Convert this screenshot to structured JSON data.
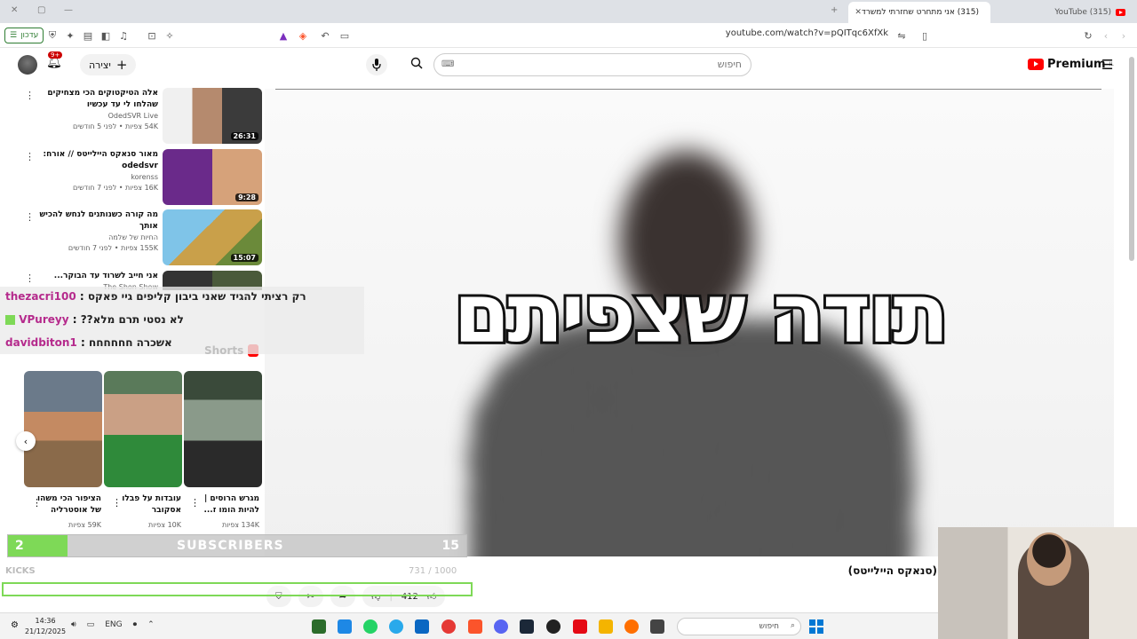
{
  "browser": {
    "tabs": [
      {
        "title": "(315) אני מתחרט שחזרתי למשרד",
        "active": true
      },
      {
        "title": "(315) YouTube",
        "active": false
      }
    ],
    "update_button": "עדכון",
    "url": "youtube.com/watch?v=pQITqc6XfXk"
  },
  "header": {
    "logo_text": "Premium",
    "logo_superscript": "IL",
    "search_placeholder": "חיפוש",
    "create_label": "יצירה",
    "notification_count": "9+"
  },
  "player": {
    "overlay_text": "תודה שצפיתם"
  },
  "video": {
    "title": "(סנאקס היילייטס)",
    "likes": "412"
  },
  "related": [
    {
      "title": "אלה הטיקטוקים הכי מצחיקים שהלחו לי עד עכשיו",
      "channel": "OdedSVR Live",
      "meta": "54K צפיות • לפני 5 חודשים",
      "duration": "26:31"
    },
    {
      "title": "מאור סנאקס היילייטס // אורח: odedsvr",
      "channel": "korenss",
      "meta": "16K צפיות • לפני 7 חודשים",
      "duration": "9:28"
    },
    {
      "title": "מה קורה כשנותנים לנחש להכיש אותך",
      "channel": "החיות של שלמה",
      "meta": "155K צפיות • לפני 7 חודשים",
      "duration": "15:07"
    },
    {
      "title": "אני חייב לשרוד עד הבוקר...",
      "channel": "The Shon Show",
      "meta": "",
      "duration": ""
    }
  ],
  "shorts": {
    "heading": "Shorts",
    "items": [
      {
        "title": "הציפור הכי משהו של אוסטרליה",
        "views": "59K צפיות"
      },
      {
        "title": "עובדות על פבלו אסקובר",
        "views": "10K צפיות"
      },
      {
        "title": "מגרש הרוסים | להיות הומו ז...",
        "views": "134K צפיות"
      }
    ]
  },
  "chat": [
    {
      "user": "thezacri100",
      "message": "רק רציתי להגיד שאני ביבון קליפים גיי פאקס"
    },
    {
      "user": "VPureyy",
      "message": "לא נסטי תרם מלא??"
    },
    {
      "user": "davidbiton1",
      "message": "אשכרה חחחחחח"
    }
  ],
  "sub_goal": {
    "current": "2",
    "label": "SUBSCRIBERS",
    "goal": "15",
    "progress": 0.13
  },
  "kicks": {
    "label": "KICKS",
    "count": "731 / 1000"
  },
  "taskbar": {
    "time": "14:36",
    "date": "21/12/2025",
    "lang": "ENG",
    "search_placeholder": "חיפוש"
  }
}
